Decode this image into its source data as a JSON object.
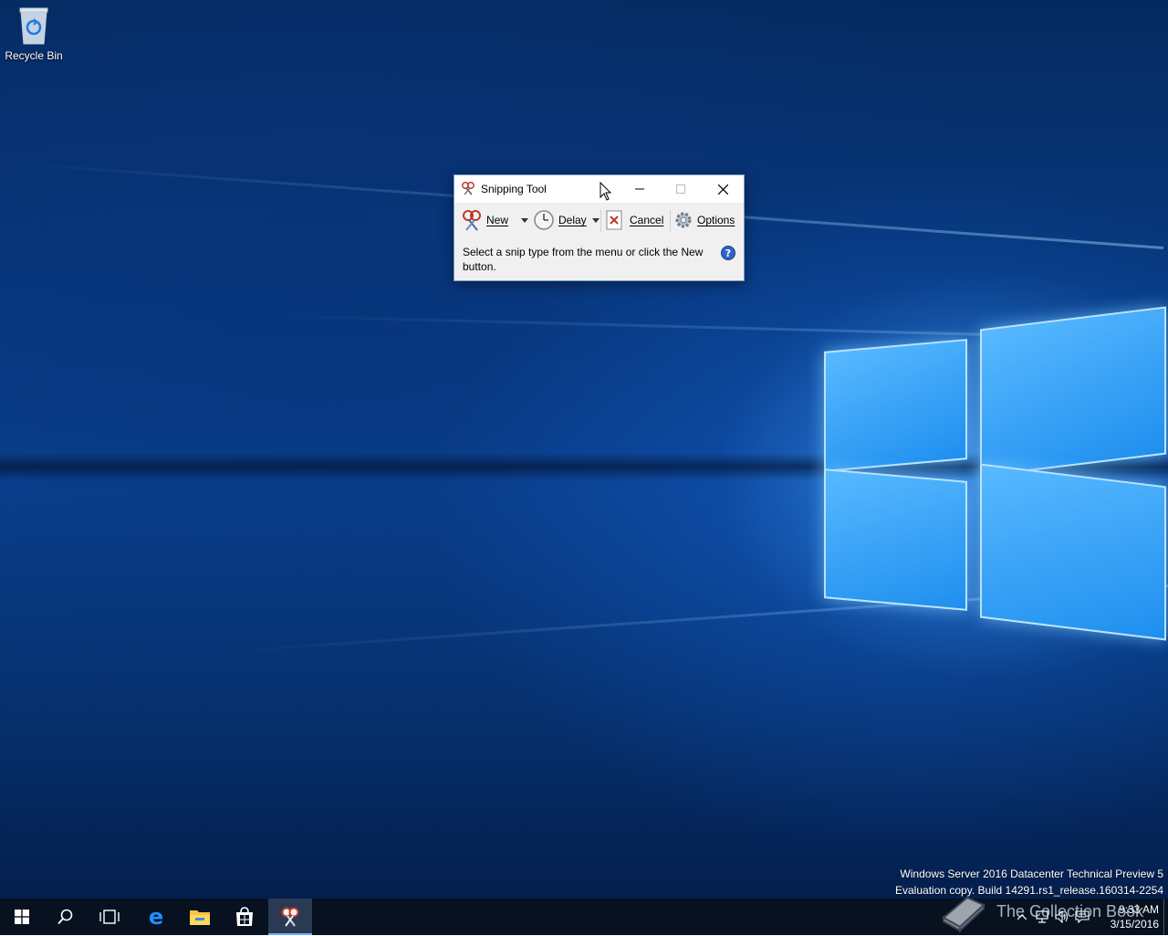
{
  "desktop": {
    "icons": [
      {
        "label": "Recycle Bin",
        "icon": "recycle-bin-icon"
      }
    ],
    "watermark": {
      "line1": "Windows Server 2016 Datacenter Technical Preview 5",
      "line2": "Evaluation copy. Build 14291.rs1_release.160314-2254"
    },
    "overlay_logo_text": "The Collection Book"
  },
  "snipping_tool": {
    "title": "Snipping Tool",
    "toolbar": {
      "new_label": "New",
      "delay_label": "Delay",
      "cancel_label": "Cancel",
      "options_label": "Options"
    },
    "status_text": "Select a snip type from the menu or click the New button.",
    "colors": {
      "window_border": "#7a9cc6",
      "body": "#f0f0f0"
    }
  },
  "taskbar": {
    "buttons": [
      "start-icon",
      "search-icon",
      "task-view-icon",
      "edge-icon",
      "file-explorer-icon",
      "store-icon",
      "snipping-tool-icon"
    ],
    "clock": {
      "time": "9:33 AM",
      "date": "3/15/2016"
    },
    "colors": {
      "background": "#07111f",
      "active": "#2a3a52",
      "accent": "#6fb0ff"
    }
  }
}
